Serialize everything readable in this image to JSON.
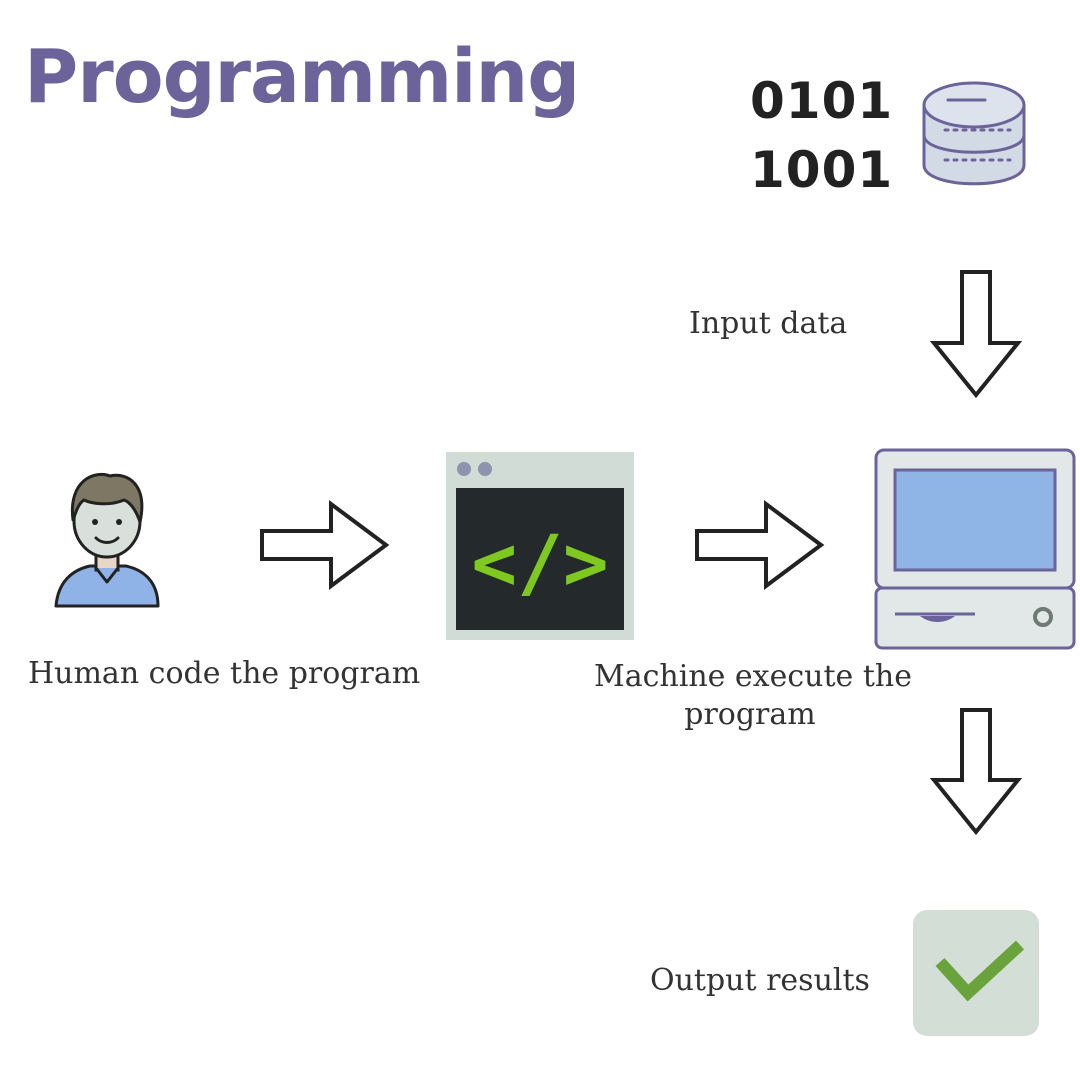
{
  "title": "Programming",
  "binary": {
    "line1": "0101",
    "line2": "1001"
  },
  "labels": {
    "input": "Input data",
    "human": "Human code the program",
    "machine_line1": "Machine execute the",
    "machine_line2": "program",
    "output": "Output results"
  },
  "code_symbol": "</>",
  "icons": {
    "database": "database-icon",
    "person": "person-icon",
    "code_window": "code-window-icon",
    "computer": "computer-icon",
    "checkmark": "checkmark-icon"
  },
  "colors": {
    "title": "#6b6399",
    "code_green": "#7ec820",
    "screen_blue": "#8fb5e6",
    "check_green": "#6aa33c",
    "check_bg": "#d3ded7",
    "person_shirt": "#8fb3e6"
  }
}
